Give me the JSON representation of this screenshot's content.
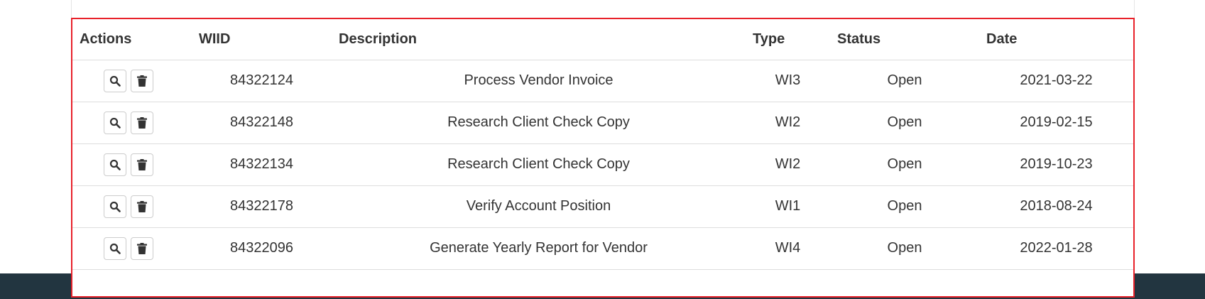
{
  "table": {
    "headers": {
      "actions": "Actions",
      "wiid": "WIID",
      "description": "Description",
      "type": "Type",
      "status": "Status",
      "date": "Date"
    },
    "rows": [
      {
        "wiid": "84322124",
        "description": "Process Vendor Invoice",
        "type": "WI3",
        "status": "Open",
        "date": "2021-03-22"
      },
      {
        "wiid": "84322148",
        "description": "Research Client Check Copy",
        "type": "WI2",
        "status": "Open",
        "date": "2019-02-15"
      },
      {
        "wiid": "84322134",
        "description": "Research Client Check Copy",
        "type": "WI2",
        "status": "Open",
        "date": "2019-10-23"
      },
      {
        "wiid": "84322178",
        "description": "Verify Account Position",
        "type": "WI1",
        "status": "Open",
        "date": "2018-08-24"
      },
      {
        "wiid": "84322096",
        "description": "Generate Yearly Report for Vendor",
        "type": "WI4",
        "status": "Open",
        "date": "2022-01-28"
      }
    ],
    "row_actions": {
      "view_icon": "search-icon",
      "delete_icon": "trash-icon"
    }
  },
  "colors": {
    "highlight_border": "#e8212a",
    "footer_bar": "#223540"
  }
}
